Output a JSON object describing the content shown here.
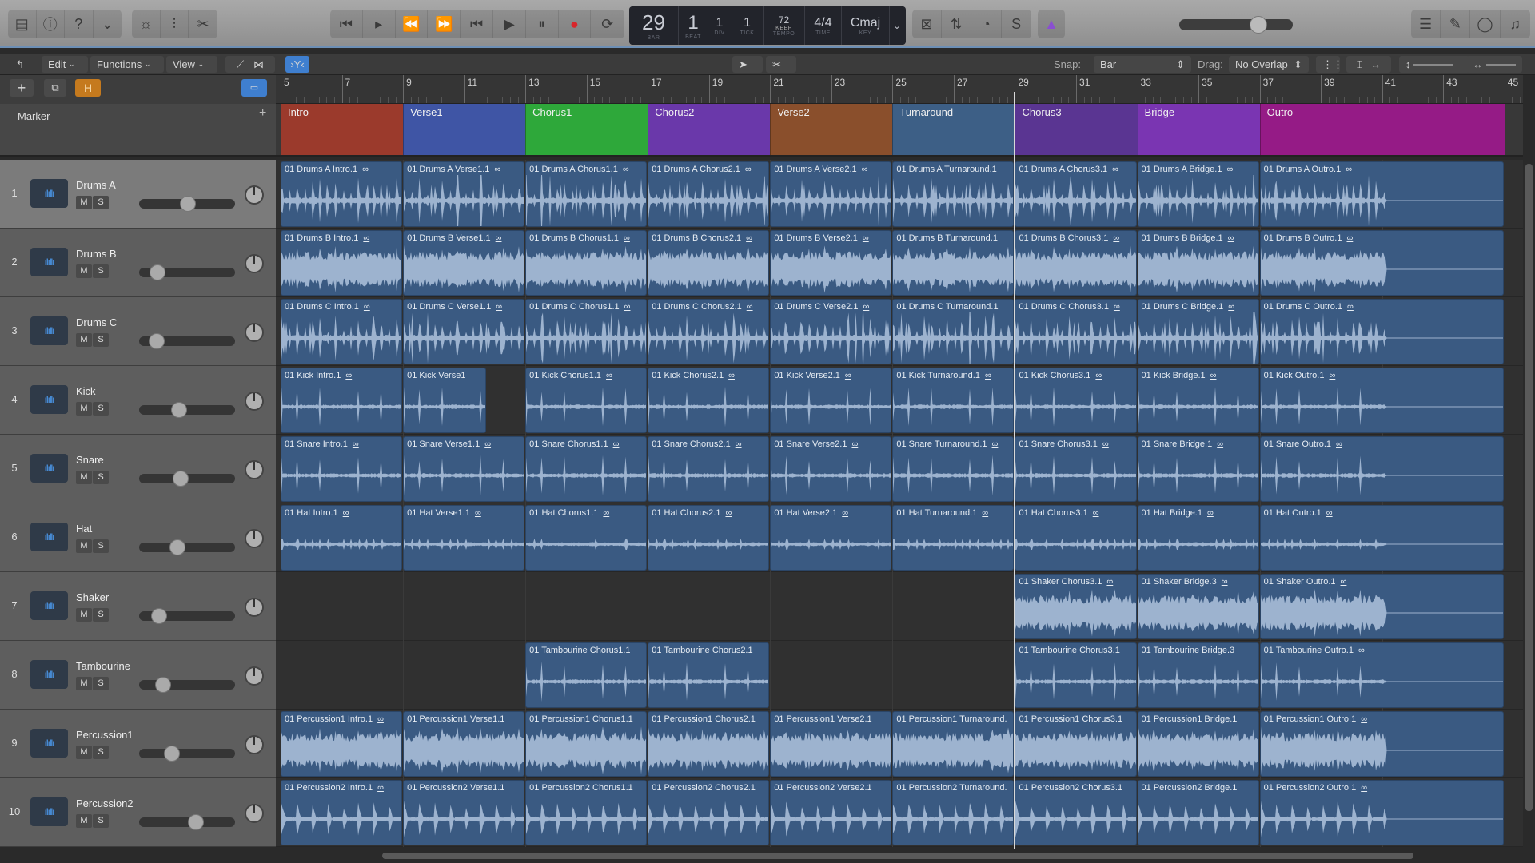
{
  "control_bar": {
    "left_buttons": [
      {
        "icon": "library-icon",
        "glyph": "▤"
      },
      {
        "icon": "info-icon",
        "glyph": "ⓘ"
      },
      {
        "icon": "help-icon",
        "glyph": "?"
      },
      {
        "icon": "toolbar-icon",
        "glyph": "⌄"
      }
    ],
    "edit_buttons": [
      {
        "icon": "smart-controls-icon",
        "glyph": "☼"
      },
      {
        "icon": "mixer-icon",
        "glyph": "⫶"
      },
      {
        "icon": "editors-icon",
        "glyph": "✂"
      }
    ],
    "transport": [
      {
        "icon": "go-to-start-icon",
        "glyph": "⏮"
      },
      {
        "icon": "play-from-selection-icon",
        "glyph": "▸"
      },
      {
        "icon": "rewind-icon",
        "glyph": "⏪"
      },
      {
        "icon": "fast-forward-icon",
        "glyph": "⏩"
      },
      {
        "icon": "go-to-beginning-icon",
        "glyph": "⏮"
      },
      {
        "icon": "play-icon",
        "glyph": "▶"
      },
      {
        "icon": "pause-icon",
        "glyph": "⏸"
      },
      {
        "icon": "record-icon",
        "glyph": "●"
      },
      {
        "icon": "cycle-icon",
        "glyph": "⟳"
      }
    ],
    "lcd": {
      "bar": "29",
      "beat": "1",
      "div": "1",
      "tick": "1",
      "bar_label": "BAR",
      "beat_label": "BEAT",
      "div_label": "DIV",
      "tick_label": "TICK",
      "tempo": "72",
      "tempo_mode": "KEEP",
      "tempo_label": "TEMPO",
      "time": "4/4",
      "time_label": "TIME",
      "key": "Cmaj",
      "key_label": "KEY"
    },
    "mode_buttons": [
      {
        "icon": "replace-icon",
        "glyph": "⊠"
      },
      {
        "icon": "tuning-icon",
        "glyph": "⇅"
      },
      {
        "icon": "count-in-icon",
        "glyph": "◔"
      },
      {
        "icon": "solo-icon",
        "glyph": "S"
      }
    ],
    "metronome": {
      "icon": "metronome-icon",
      "glyph": "▲",
      "active": true,
      "color": "#8a4fd0"
    },
    "master_volume": 0.7,
    "right_buttons": [
      {
        "icon": "list-editors-icon",
        "glyph": "☰"
      },
      {
        "icon": "notepad-icon",
        "glyph": "✎"
      },
      {
        "icon": "loop-browser-icon",
        "glyph": "◯"
      },
      {
        "icon": "browsers-icon",
        "glyph": "♫"
      }
    ]
  },
  "toolbar": {
    "edit": "Edit",
    "functions": "Functions",
    "view": "View",
    "snap_label": "Snap:",
    "snap_value": "Bar",
    "drag_label": "Drag:",
    "drag_value": "No Overlap"
  },
  "ruler": {
    "first_bar": 5,
    "last_bar": 45,
    "labels": [
      "5",
      "7",
      "9",
      "11",
      "13",
      "15",
      "17",
      "19",
      "21",
      "23",
      "25",
      "27",
      "29",
      "31",
      "33",
      "35",
      "37",
      "39",
      "41",
      "43",
      "45"
    ]
  },
  "playhead_bar": 29,
  "marker_track": {
    "label": "Marker",
    "add": "+",
    "markers": [
      {
        "name": "Intro",
        "start": 5,
        "end": 9,
        "color": "#9b3a2c"
      },
      {
        "name": "Verse1",
        "start": 9,
        "end": 13,
        "color": "#3f55a5"
      },
      {
        "name": "Chorus1",
        "start": 13,
        "end": 17,
        "color": "#2ea83a"
      },
      {
        "name": "Chorus2",
        "start": 17,
        "end": 21,
        "color": "#6a38aa"
      },
      {
        "name": "Verse2",
        "start": 21,
        "end": 25,
        "color": "#8a4f2c"
      },
      {
        "name": "Turnaround",
        "start": 25,
        "end": 29,
        "color": "#3d5f86"
      },
      {
        "name": "Chorus3",
        "start": 29,
        "end": 33,
        "color": "#5a3592"
      },
      {
        "name": "Bridge",
        "start": 33,
        "end": 37,
        "color": "#7a35b2"
      },
      {
        "name": "Outro",
        "start": 37,
        "end": 45,
        "color": "#951b86"
      }
    ]
  },
  "colors": {
    "region": "#3a5a82",
    "waveform": "#9db3cf",
    "header_accent": "#4fa3ff"
  },
  "tracks": [
    {
      "num": "1",
      "name": "Drums A",
      "mute": "M",
      "solo": "S",
      "volume": 0.51,
      "selected": true,
      "style": "hits",
      "regions": [
        [
          "01 Drums A Intro.1",
          5,
          9,
          1
        ],
        [
          "01 Drums A Verse1.1",
          9,
          13,
          1
        ],
        [
          "01 Drums A Chorus1.1",
          13,
          17,
          1
        ],
        [
          "01 Drums A Chorus2.1",
          17,
          21,
          1
        ],
        [
          "01 Drums A Verse2.1",
          21,
          25,
          1
        ],
        [
          "01 Drums A Turnaround.1",
          25,
          29,
          0
        ],
        [
          "01 Drums A Chorus3.1",
          29,
          33,
          1
        ],
        [
          "01 Drums A Bridge.1",
          33,
          37,
          1
        ],
        [
          "01 Drums A Outro.1",
          37,
          45,
          1
        ]
      ]
    },
    {
      "num": "2",
      "name": "Drums B",
      "mute": "M",
      "solo": "S",
      "volume": 0.19,
      "style": "dense",
      "regions": [
        [
          "01 Drums B Intro.1",
          5,
          9,
          1
        ],
        [
          "01 Drums B Verse1.1",
          9,
          13,
          1
        ],
        [
          "01 Drums B Chorus1.1",
          13,
          17,
          1
        ],
        [
          "01 Drums B Chorus2.1",
          17,
          21,
          1
        ],
        [
          "01 Drums B Verse2.1",
          21,
          25,
          1
        ],
        [
          "01 Drums B Turnaround.1",
          25,
          29,
          0
        ],
        [
          "01 Drums B Chorus3.1",
          29,
          33,
          1
        ],
        [
          "01 Drums B Bridge.1",
          33,
          37,
          1
        ],
        [
          "01 Drums B Outro.1",
          37,
          45,
          1
        ]
      ]
    },
    {
      "num": "3",
      "name": "Drums C",
      "mute": "M",
      "solo": "S",
      "volume": 0.18,
      "style": "hits",
      "regions": [
        [
          "01 Drums C Intro.1",
          5,
          9,
          1
        ],
        [
          "01 Drums C Verse1.1",
          9,
          13,
          1
        ],
        [
          "01 Drums C Chorus1.1",
          13,
          17,
          1
        ],
        [
          "01 Drums C Chorus2.1",
          17,
          21,
          1
        ],
        [
          "01 Drums C Verse2.1",
          21,
          25,
          1
        ],
        [
          "01 Drums C Turnaround.1",
          25,
          29,
          0
        ],
        [
          "01 Drums C Chorus3.1",
          29,
          33,
          1
        ],
        [
          "01 Drums C Bridge.1",
          33,
          37,
          1
        ],
        [
          "01 Drums C Outro.1",
          37,
          45,
          1
        ]
      ]
    },
    {
      "num": "4",
      "name": "Kick",
      "mute": "M",
      "solo": "S",
      "volume": 0.42,
      "style": "sparse",
      "regions": [
        [
          "01 Kick Intro.1",
          5,
          9,
          1
        ],
        [
          "01 Kick Verse1",
          9,
          11.75,
          0
        ],
        [
          "01 Kick Chorus1.1",
          13,
          17,
          1
        ],
        [
          "01 Kick Chorus2.1",
          17,
          21,
          1
        ],
        [
          "01 Kick Verse2.1",
          21,
          25,
          1
        ],
        [
          "01 Kick Turnaround.1",
          25,
          29,
          1
        ],
        [
          "01 Kick Chorus3.1",
          29,
          33,
          1
        ],
        [
          "01 Kick Bridge.1",
          33,
          37,
          1
        ],
        [
          "01 Kick Outro.1",
          37,
          45,
          1
        ]
      ]
    },
    {
      "num": "5",
      "name": "Snare",
      "mute": "M",
      "solo": "S",
      "volume": 0.43,
      "style": "sparse",
      "regions": [
        [
          "01 Snare Intro.1",
          5,
          9,
          1
        ],
        [
          "01 Snare Verse1.1",
          9,
          13,
          1
        ],
        [
          "01 Snare Chorus1.1",
          13,
          17,
          1
        ],
        [
          "01 Snare Chorus2.1",
          17,
          21,
          1
        ],
        [
          "01 Snare Verse2.1",
          21,
          25,
          1
        ],
        [
          "01 Snare Turnaround.1",
          25,
          29,
          1
        ],
        [
          "01 Snare Chorus3.1",
          29,
          33,
          1
        ],
        [
          "01 Snare Bridge.1",
          33,
          37,
          1
        ],
        [
          "01 Snare Outro.1",
          37,
          45,
          1
        ]
      ]
    },
    {
      "num": "6",
      "name": "Hat",
      "mute": "M",
      "solo": "S",
      "volume": 0.4,
      "style": "tiny",
      "regions": [
        [
          "01 Hat Intro.1",
          5,
          9,
          1
        ],
        [
          "01 Hat Verse1.1",
          9,
          13,
          1
        ],
        [
          "01 Hat Chorus1.1",
          13,
          17,
          1
        ],
        [
          "01 Hat Chorus2.1",
          17,
          21,
          1
        ],
        [
          "01 Hat Verse2.1",
          21,
          25,
          1
        ],
        [
          "01 Hat Turnaround.1",
          25,
          29,
          1
        ],
        [
          "01 Hat Chorus3.1",
          29,
          33,
          1
        ],
        [
          "01 Hat Bridge.1",
          33,
          37,
          1
        ],
        [
          "01 Hat Outro.1",
          37,
          45,
          1
        ]
      ]
    },
    {
      "num": "7",
      "name": "Shaker",
      "mute": "M",
      "solo": "S",
      "volume": 0.21,
      "style": "dense",
      "regions": [
        [
          "01 Shaker Chorus3.1",
          29,
          33,
          1
        ],
        [
          "01 Shaker Bridge.3",
          33,
          37,
          1
        ],
        [
          "01 Shaker Outro.1",
          37,
          45,
          1
        ]
      ]
    },
    {
      "num": "8",
      "name": "Tambourine",
      "mute": "M",
      "solo": "S",
      "volume": 0.25,
      "style": "sparse",
      "regions": [
        [
          "01 Tambourine Chorus1.1",
          13,
          17,
          0
        ],
        [
          "01 Tambourine Chorus2.1",
          17,
          21,
          0
        ],
        [
          "01 Tambourine Chorus3.1",
          29,
          33,
          0
        ],
        [
          "01 Tambourine Bridge.3",
          33,
          37,
          0
        ],
        [
          "01 Tambourine Outro.1",
          37,
          45,
          1
        ]
      ]
    },
    {
      "num": "9",
      "name": "Percussion1",
      "mute": "M",
      "solo": "S",
      "volume": 0.34,
      "style": "dense",
      "regions": [
        [
          "01 Percussion1 Intro.1",
          5,
          9,
          1
        ],
        [
          "01 Percussion1 Verse1.1",
          9,
          13,
          0
        ],
        [
          "01 Percussion1 Chorus1.1",
          13,
          17,
          0
        ],
        [
          "01 Percussion1 Chorus2.1",
          17,
          21,
          0
        ],
        [
          "01 Percussion1 Verse2.1",
          21,
          25,
          0
        ],
        [
          "01 Percussion1 Turnaround.",
          25,
          29,
          0
        ],
        [
          "01 Percussion1 Chorus3.1",
          29,
          33,
          0
        ],
        [
          "01 Percussion1 Bridge.1",
          33,
          37,
          0
        ],
        [
          "01 Percussion1 Outro.1",
          37,
          45,
          1
        ]
      ]
    },
    {
      "num": "10",
      "name": "Percussion2",
      "mute": "M",
      "solo": "S",
      "volume": 0.59,
      "style": "blobs",
      "regions": [
        [
          "01 Percussion2 Intro.1",
          5,
          9,
          1
        ],
        [
          "01 Percussion2 Verse1.1",
          9,
          13,
          0
        ],
        [
          "01 Percussion2 Chorus1.1",
          13,
          17,
          0
        ],
        [
          "01 Percussion2 Chorus2.1",
          17,
          21,
          0
        ],
        [
          "01 Percussion2 Verse2.1",
          21,
          25,
          0
        ],
        [
          "01 Percussion2 Turnaround.",
          25,
          29,
          0
        ],
        [
          "01 Percussion2 Chorus3.1",
          29,
          33,
          0
        ],
        [
          "01 Percussion2 Bridge.1",
          33,
          37,
          0
        ],
        [
          "01 Percussion2 Outro.1",
          37,
          45,
          1
        ]
      ]
    }
  ]
}
